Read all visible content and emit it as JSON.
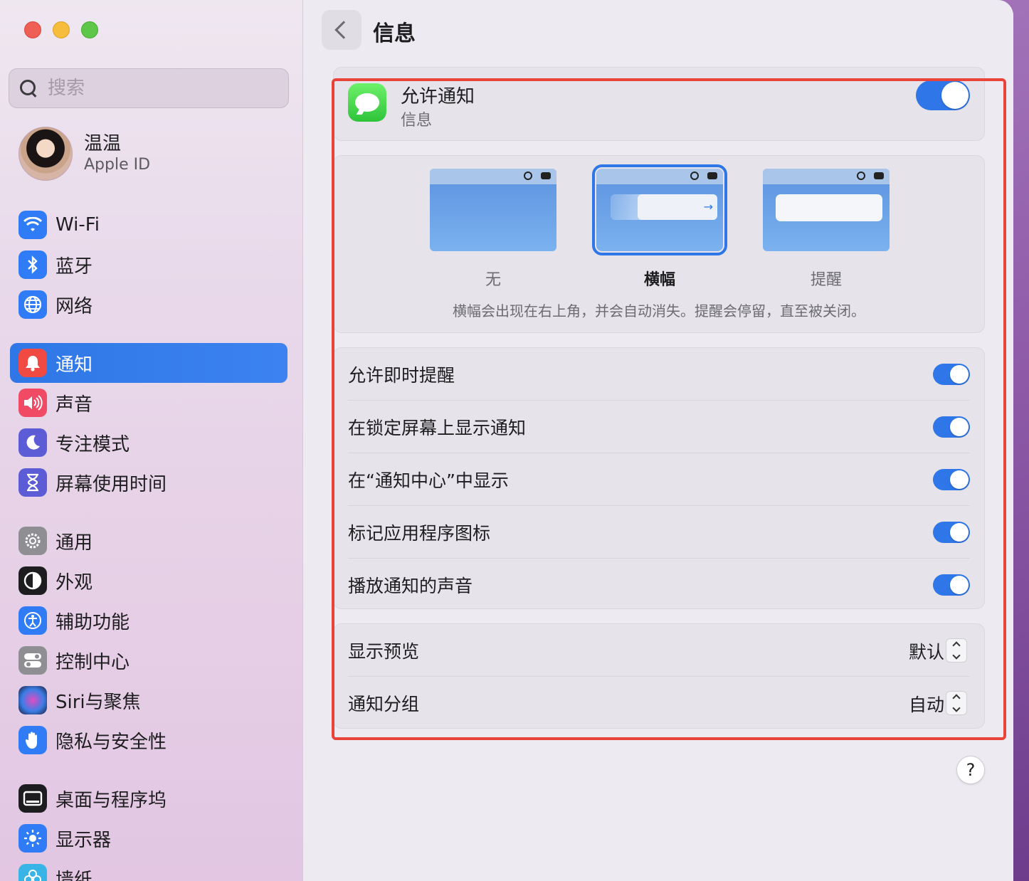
{
  "colors": {
    "accent": "#2f76e9",
    "highlight": "#e8443a"
  },
  "search": {
    "placeholder": "搜索"
  },
  "profile": {
    "name": "温温",
    "subtitle": "Apple ID"
  },
  "sidebar": {
    "group1": [
      {
        "label": "Wi-Fi",
        "icon": "wifi-icon",
        "color": "#2f7cf6"
      },
      {
        "label": "蓝牙",
        "icon": "bluetooth-icon",
        "color": "#2f7cf6"
      },
      {
        "label": "网络",
        "icon": "globe-icon",
        "color": "#2f7cf6"
      }
    ],
    "group2": [
      {
        "label": "通知",
        "icon": "bell-icon",
        "color": "#f04a43",
        "active": true
      },
      {
        "label": "声音",
        "icon": "speaker-icon",
        "color": "#f04a65"
      },
      {
        "label": "专注模式",
        "icon": "moon-icon",
        "color": "#5b5cd6"
      },
      {
        "label": "屏幕使用时间",
        "icon": "hourglass-icon",
        "color": "#5b5cd6"
      }
    ],
    "group3": [
      {
        "label": "通用",
        "icon": "gear-icon",
        "color": "#8e8e93"
      },
      {
        "label": "外观",
        "icon": "appearance-icon",
        "color": "#1d1d1f"
      },
      {
        "label": "辅助功能",
        "icon": "accessibility-icon",
        "color": "#2f7cf6"
      },
      {
        "label": "控制中心",
        "icon": "control-center-icon",
        "color": "#8e8e93"
      },
      {
        "label": "Siri与聚焦",
        "icon": "siri-icon",
        "color": "#3a2f6b"
      },
      {
        "label": "隐私与安全性",
        "icon": "hand-icon",
        "color": "#2f7cf6"
      }
    ],
    "group4": [
      {
        "label": "桌面与程序坞",
        "icon": "dock-icon",
        "color": "#1d1d1f"
      },
      {
        "label": "显示器",
        "icon": "sun-icon",
        "color": "#2f7cf6"
      },
      {
        "label": "墙纸",
        "icon": "flower-icon",
        "color": "#39b4e6"
      }
    ]
  },
  "header": {
    "title": "信息"
  },
  "allow": {
    "title": "允许通知",
    "subtitle": "信息",
    "enabled": true
  },
  "alert_styles": {
    "options": [
      {
        "label": "无",
        "selected": false
      },
      {
        "label": "横幅",
        "selected": true
      },
      {
        "label": "提醒",
        "selected": false
      }
    ],
    "description": "横幅会出现在右上角，并会自动消失。提醒会停留，直至被关闭。"
  },
  "toggles": [
    {
      "label": "允许即时提醒",
      "enabled": true
    },
    {
      "label": "在锁定屏幕上显示通知",
      "enabled": true
    },
    {
      "label": "在“通知中心”中显示",
      "enabled": true
    },
    {
      "label": "标记应用程序图标",
      "enabled": true
    },
    {
      "label": "播放通知的声音",
      "enabled": true
    }
  ],
  "selects": [
    {
      "label": "显示预览",
      "value": "默认"
    },
    {
      "label": "通知分组",
      "value": "自动"
    }
  ],
  "help": {
    "label": "?"
  }
}
